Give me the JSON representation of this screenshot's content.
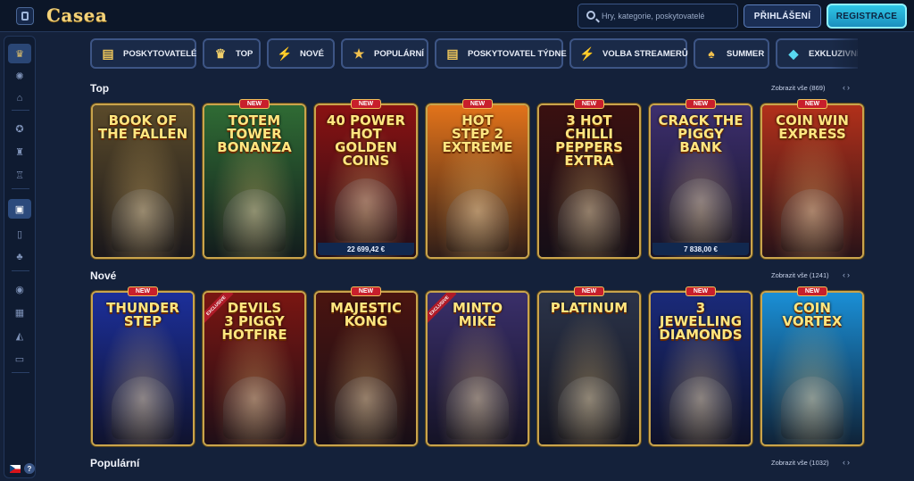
{
  "header": {
    "logo_text": "Casea",
    "search_placeholder": "Hry, kategorie, poskytovatelé",
    "login_label": "PŘIHLÁŠENÍ",
    "register_label": "REGISTRACE"
  },
  "sidebar": {
    "items": [
      {
        "name": "sidebar-item-home",
        "icon": "crown-icon",
        "glyph": "♛"
      },
      {
        "name": "sidebar-item-wheel",
        "icon": "wheel-icon",
        "glyph": "✺"
      },
      {
        "name": "sidebar-item-gifts",
        "icon": "gift-icon",
        "glyph": "⌂"
      },
      {
        "name": "sidebar-item-rewards",
        "icon": "medal-icon",
        "glyph": "✪"
      },
      {
        "name": "sidebar-item-tournaments",
        "icon": "trophy-icon",
        "glyph": "♜"
      },
      {
        "name": "sidebar-item-levels",
        "icon": "trophy-cup-icon",
        "glyph": "♖"
      },
      {
        "name": "sidebar-item-casino",
        "icon": "slot-icon",
        "glyph": "▣"
      },
      {
        "name": "sidebar-item-mobile",
        "icon": "phone-icon",
        "glyph": "▯"
      },
      {
        "name": "sidebar-item-lucky",
        "icon": "clover-icon",
        "glyph": "♣"
      },
      {
        "name": "sidebar-item-sport",
        "icon": "ball-icon",
        "glyph": "◉"
      },
      {
        "name": "sidebar-item-live",
        "icon": "table-icon",
        "glyph": "▦"
      },
      {
        "name": "sidebar-item-promo",
        "icon": "megaphone-icon",
        "glyph": "◭"
      },
      {
        "name": "sidebar-item-tv",
        "icon": "tv-icon",
        "glyph": "▭"
      }
    ],
    "language": "CZ",
    "help_label": "?"
  },
  "categories": [
    {
      "label": "POSKYTOVATELÉ",
      "icon": "cards-icon",
      "glyph": "▤",
      "color": "#e9c25a"
    },
    {
      "label": "TOP",
      "icon": "crown-icon",
      "glyph": "♛",
      "color": "#f0cf6a"
    },
    {
      "label": "NOVÉ",
      "icon": "lightning-icon",
      "glyph": "⚡",
      "color": "#4ad6e8"
    },
    {
      "label": "POPULÁRNÍ",
      "icon": "star-icon",
      "glyph": "★",
      "color": "#f2c14e"
    },
    {
      "label": "POSKYTOVATEL TÝDNE",
      "icon": "cards-icon",
      "glyph": "▤",
      "color": "#e9c25a"
    },
    {
      "label": "VOLBA STREAMERŮ",
      "icon": "lightning-icon",
      "glyph": "⚡",
      "color": "#4ad6e8"
    },
    {
      "label": "SUMMER",
      "icon": "palm-icon",
      "glyph": "♠",
      "color": "#f2c14e"
    },
    {
      "label": "EXKLUZIVNÍ",
      "icon": "diamond-icon",
      "glyph": "◆",
      "color": "#58d8f0"
    }
  ],
  "sections": [
    {
      "title": "Top",
      "view_all": "Zobrazit vše (869)",
      "games": [
        {
          "title": "BOOK OF\nTHE FALLEN",
          "new": false,
          "exclusive": false,
          "prize": "",
          "bg": "#5a4a2a"
        },
        {
          "title": "TOTEM\nTOWER\nBONANZA",
          "new": true,
          "exclusive": false,
          "prize": "",
          "bg": "#2f6b34"
        },
        {
          "title": "40 POWER HOT\nGOLDEN COINS",
          "new": true,
          "exclusive": false,
          "prize": "22 699,42 €",
          "bg": "#8a1212"
        },
        {
          "title": "HOT\nSTEP 2\nEXTREME",
          "new": true,
          "exclusive": false,
          "prize": "",
          "bg": "#e2731a"
        },
        {
          "title": "3 HOT CHILLI\nPEPPERS\nEXTRA",
          "new": true,
          "exclusive": false,
          "prize": "",
          "bg": "#3a1010"
        },
        {
          "title": "CRACK THE\nPIGGY BANK",
          "new": true,
          "exclusive": false,
          "prize": "7 838,00 €",
          "bg": "#3d2f6e"
        },
        {
          "title": "COIN WIN\nEXPRESS",
          "new": true,
          "exclusive": false,
          "prize": "",
          "bg": "#b2301a"
        }
      ]
    },
    {
      "title": "Nové",
      "view_all": "Zobrazit vše (1241)",
      "games": [
        {
          "title": "THUNDER\nSTEP",
          "new": true,
          "exclusive": false,
          "prize": "",
          "bg": "#1c2f9a"
        },
        {
          "title": "DEVILS\n3 PIGGY\nHOTFIRE",
          "new": false,
          "exclusive": true,
          "prize": "",
          "bg": "#7a1612"
        },
        {
          "title": "MAJESTIC\nKONG",
          "new": true,
          "exclusive": false,
          "prize": "",
          "bg": "#4a1410"
        },
        {
          "title": "MINTO\nMIKE",
          "new": false,
          "exclusive": true,
          "prize": "",
          "bg": "#3a2f6a"
        },
        {
          "title": "PLATINUM",
          "new": true,
          "exclusive": false,
          "prize": "",
          "bg": "#2b3348"
        },
        {
          "title": "3 JEWELLING\nDIAMONDS",
          "new": true,
          "exclusive": false,
          "prize": "",
          "bg": "#1a2a7a"
        },
        {
          "title": "COIN\nVORTEX",
          "new": true,
          "exclusive": false,
          "prize": "",
          "bg": "#1a8fd6"
        }
      ]
    },
    {
      "title": "Populární",
      "view_all": "Zobrazit vše (1032)",
      "games": []
    }
  ],
  "labels": {
    "new_badge": "NEW",
    "exclusive_badge": "EXCLUSIVE"
  },
  "colors": {
    "accent_gold": "#c9a44c",
    "accent_cyan": "#2ec7e6",
    "bg": "#14213a"
  }
}
